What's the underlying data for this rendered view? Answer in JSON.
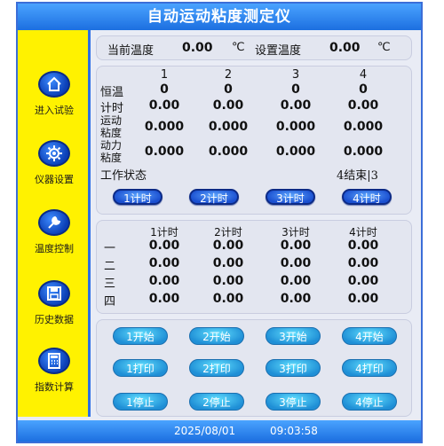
{
  "title": "自动运动粘度测定仪",
  "sidebar": {
    "items": [
      {
        "label": "进入试验",
        "icon": "home-icon"
      },
      {
        "label": "仪器设置",
        "icon": "gear-icon"
      },
      {
        "label": "温度控制",
        "icon": "tools-icon"
      },
      {
        "label": "历史数据",
        "icon": "save-icon"
      },
      {
        "label": "指数计算",
        "icon": "calculator-icon"
      }
    ]
  },
  "temperature": {
    "current_label": "当前温度",
    "current_value": "0.00",
    "current_unit": "℃",
    "set_label": "设置温度",
    "set_value": "0.00",
    "set_unit": "℃"
  },
  "channels": {
    "headers": [
      "1",
      "2",
      "3",
      "4"
    ],
    "constant_temp_label": "恒温",
    "constant_temp": [
      "0",
      "0",
      "0",
      "0"
    ],
    "timing_label": "计时",
    "timing": [
      "0.00",
      "0.00",
      "0.00",
      "0.00"
    ],
    "kinematic_label_1": "运动",
    "kinematic_label_2": "粘度",
    "kinematic": [
      "0.000",
      "0.000",
      "0.000",
      "0.000"
    ],
    "dynamic_label_1": "动力",
    "dynamic_label_2": "粘度",
    "dynamic": [
      "0.000",
      "0.000",
      "0.000",
      "0.000"
    ],
    "work_status_label": "工作状态",
    "work_status_value": "4结束|3",
    "timer_buttons": [
      "1计时",
      "2计时",
      "3计时",
      "4计时"
    ]
  },
  "timing_table": {
    "headers": [
      "1计时",
      "2计时",
      "3计时",
      "4计时"
    ],
    "rows": [
      {
        "label": "一",
        "values": [
          "0.00",
          "0.00",
          "0.00",
          "0.00"
        ]
      },
      {
        "label": "二",
        "values": [
          "0.00",
          "0.00",
          "0.00",
          "0.00"
        ]
      },
      {
        "label": "三",
        "values": [
          "0.00",
          "0.00",
          "0.00",
          "0.00"
        ]
      },
      {
        "label": "四",
        "values": [
          "0.00",
          "0.00",
          "0.00",
          "0.00"
        ]
      }
    ]
  },
  "controls": {
    "start": [
      "1开始",
      "2开始",
      "3开始",
      "4开始"
    ],
    "print": [
      "1打印",
      "2打印",
      "3打印",
      "4打印"
    ],
    "stop": [
      "1停止",
      "2停止",
      "3停止",
      "4停止"
    ]
  },
  "status_bar": {
    "date": "2025/08/01",
    "time": "09:03:58"
  }
}
